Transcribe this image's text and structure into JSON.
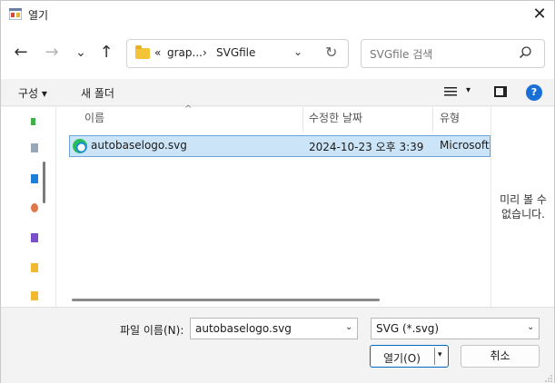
{
  "window": {
    "title": "열기",
    "close_glyph": "✕"
  },
  "nav": {
    "back_glyph": "←",
    "forward_glyph": "→",
    "recent_glyph": "⌄",
    "up_glyph": "↑",
    "breadcrumb": [
      "«",
      "grap...",
      "›",
      "SVGfile"
    ],
    "dropdown_glyph": "⌄",
    "refresh_glyph": "↻"
  },
  "search": {
    "placeholder": "SVGfile 검색"
  },
  "commandbar": {
    "organize": "구성 ▾",
    "new_folder": "새 폴더",
    "view_dropdown": "▾",
    "help": "?"
  },
  "filelist": {
    "columns": [
      "이름",
      "수정한 날짜",
      "유형"
    ],
    "sort_indicator": "^",
    "rows": [
      {
        "name": "autobaselogo.svg",
        "modified": "2024-10-23 오후 3:39",
        "type": "Microsoft"
      }
    ]
  },
  "preview": {
    "text_line1": "미리 볼 수",
    "text_line2": "없습니다."
  },
  "bottom": {
    "filename_label": "파일 이름(N):",
    "filename_value": "autobaselogo.svg",
    "filetype_value": "SVG (*.svg)",
    "open_label": "열기(O)",
    "cancel_label": "취소",
    "dropdown_glyph": "⌄",
    "split_glyph": "▾"
  },
  "colors": {
    "accent": "#0067c0",
    "selection": "#cce4f7",
    "help": "#1a6fd6"
  }
}
